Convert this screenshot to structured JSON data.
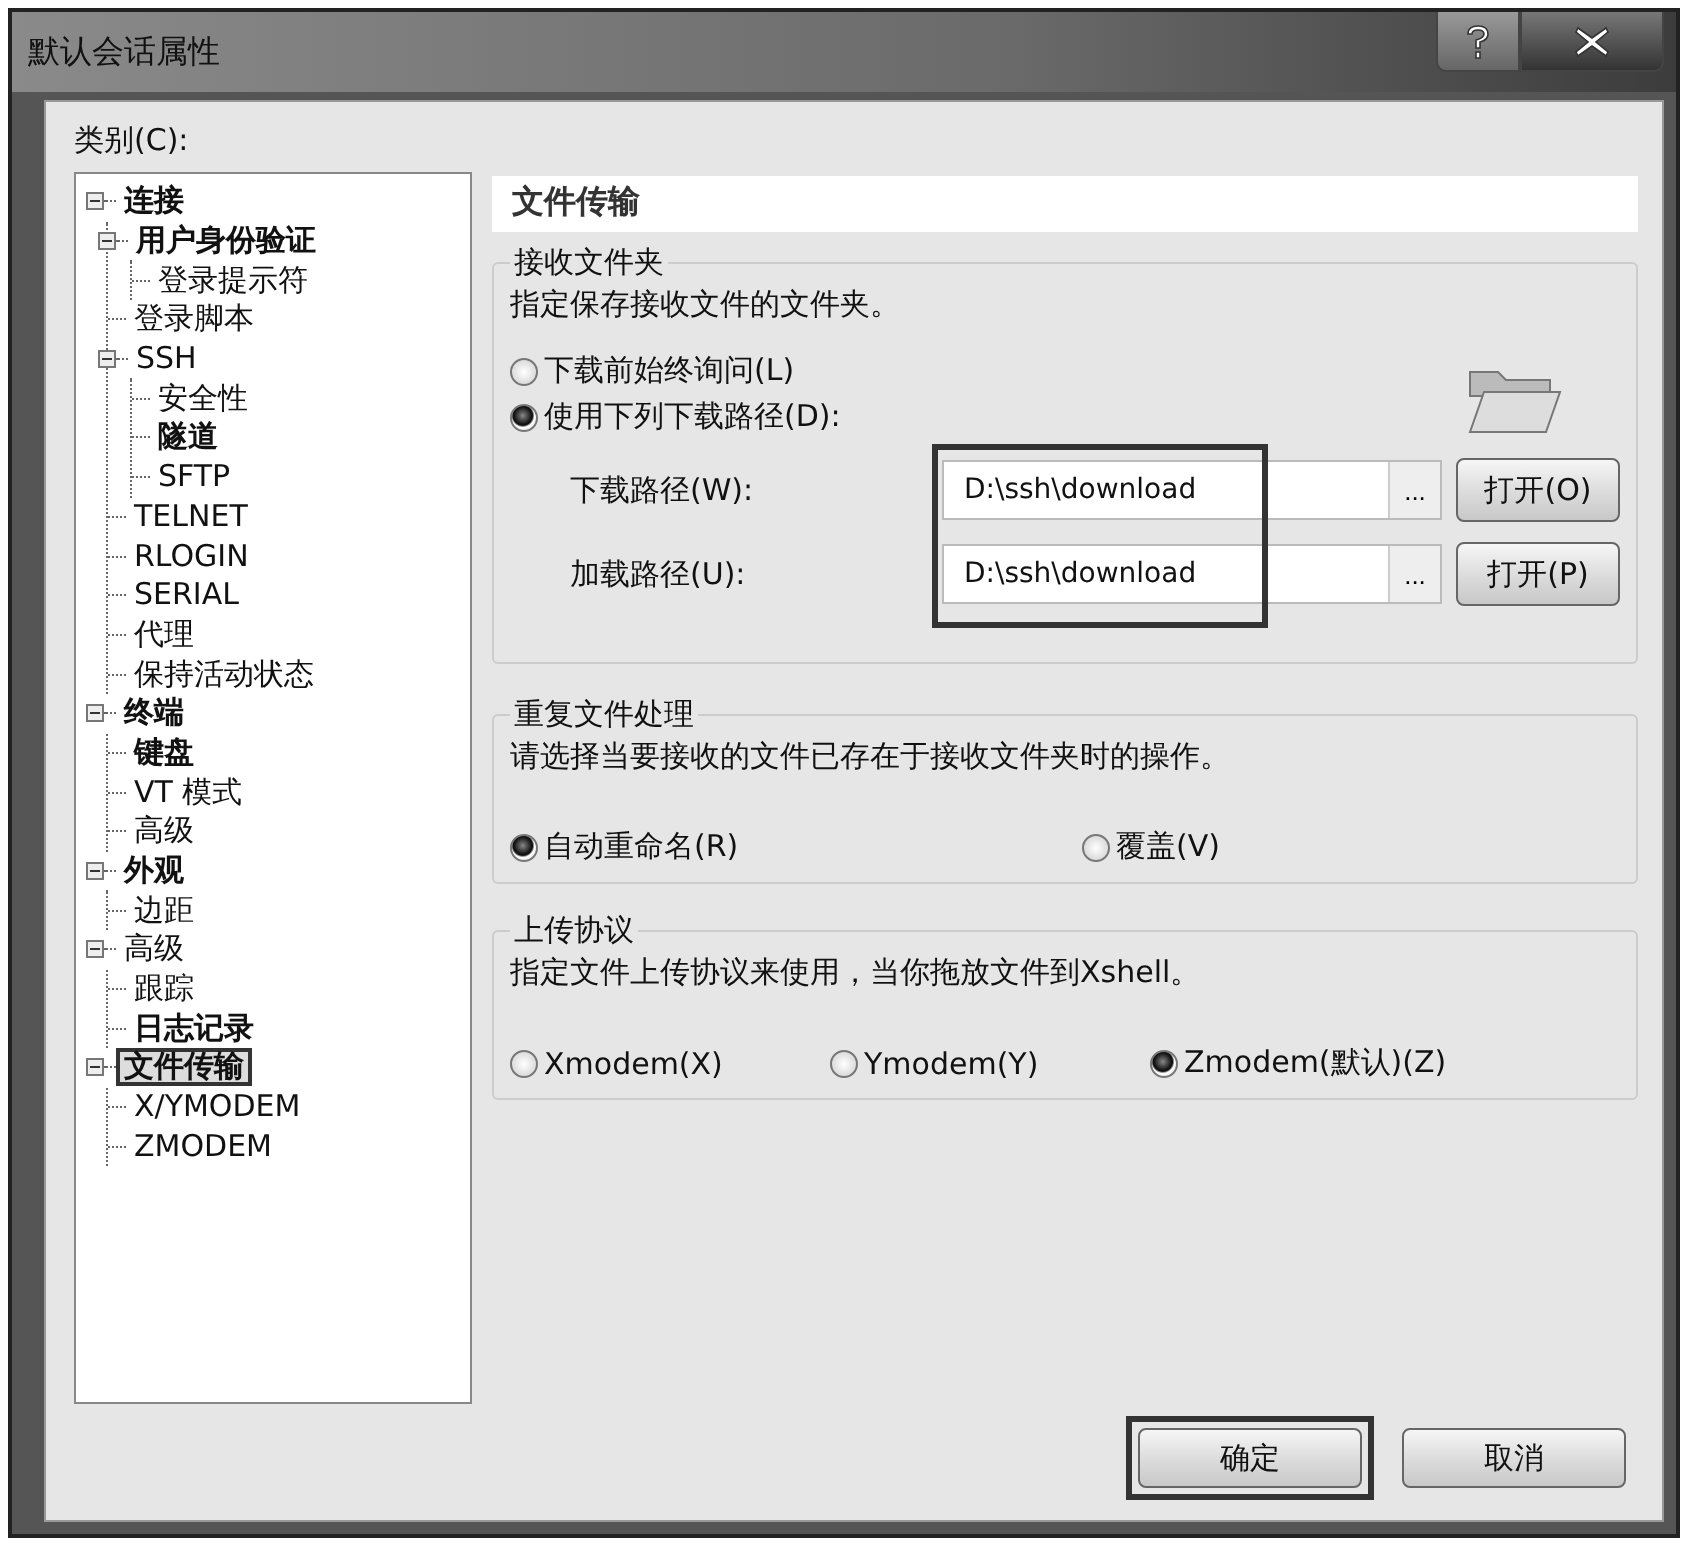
{
  "window": {
    "title": "默认会话属性"
  },
  "category_label": "类别(C):",
  "tree": [
    {
      "label": "连接",
      "bold": true,
      "expanded": true,
      "selected": false,
      "children": [
        {
          "label": "用户身份验证",
          "bold": true,
          "expanded": true,
          "selected": false,
          "children": [
            {
              "label": "登录提示符",
              "bold": false,
              "selected": false
            }
          ]
        },
        {
          "label": "登录脚本",
          "bold": false,
          "selected": false
        },
        {
          "label": "SSH",
          "bold": false,
          "expanded": true,
          "selected": false,
          "children": [
            {
              "label": "安全性",
              "bold": false,
              "selected": false
            },
            {
              "label": "隧道",
              "bold": true,
              "selected": false
            },
            {
              "label": "SFTP",
              "bold": false,
              "selected": false
            }
          ]
        },
        {
          "label": "TELNET",
          "bold": false,
          "selected": false
        },
        {
          "label": "RLOGIN",
          "bold": false,
          "selected": false
        },
        {
          "label": "SERIAL",
          "bold": false,
          "selected": false
        },
        {
          "label": "代理",
          "bold": false,
          "selected": false
        },
        {
          "label": "保持活动状态",
          "bold": false,
          "selected": false
        }
      ]
    },
    {
      "label": "终端",
      "bold": true,
      "expanded": true,
      "selected": false,
      "children": [
        {
          "label": "键盘",
          "bold": true,
          "selected": false
        },
        {
          "label": "VT 模式",
          "bold": false,
          "selected": false
        },
        {
          "label": "高级",
          "bold": false,
          "selected": false
        }
      ]
    },
    {
      "label": "外观",
      "bold": true,
      "expanded": true,
      "selected": false,
      "children": [
        {
          "label": "边距",
          "bold": false,
          "selected": false
        }
      ]
    },
    {
      "label": "高级",
      "bold": false,
      "expanded": true,
      "selected": false,
      "children": [
        {
          "label": "跟踪",
          "bold": false,
          "selected": false
        },
        {
          "label": "日志记录",
          "bold": true,
          "selected": false
        }
      ]
    },
    {
      "label": "文件传输",
      "bold": true,
      "expanded": true,
      "selected": true,
      "children": [
        {
          "label": "X/YMODEM",
          "bold": false,
          "selected": false
        },
        {
          "label": "ZMODEM",
          "bold": false,
          "selected": false
        }
      ]
    }
  ],
  "panel_title": "文件传输",
  "receive_folder": {
    "title": "接收文件夹",
    "description": "指定保存接收文件的文件夹。",
    "options": [
      {
        "label": "下载前始终询问(L)",
        "selected": false
      },
      {
        "label": "使用下列下载路径(D):",
        "selected": true
      }
    ],
    "highlighted": true,
    "paths": [
      {
        "label": "下载路径(W):",
        "value": "D:\\ssh\\download",
        "browse": "...",
        "open": "打开(O)"
      },
      {
        "label": "加载路径(U):",
        "value": "D:\\ssh\\download",
        "browse": "...",
        "open": "打开(P)"
      }
    ]
  },
  "duplicate": {
    "title": "重复文件处理",
    "description": "请选择当要接收的文件已存在于接收文件夹时的操作。",
    "options": [
      {
        "label": "自动重命名(R)",
        "selected": true
      },
      {
        "label": "覆盖(V)",
        "selected": false
      }
    ]
  },
  "upload": {
    "title": "上传协议",
    "description": "指定文件上传协议来使用，当你拖放文件到Xshell。",
    "options": [
      {
        "label": "Xmodem(X)",
        "selected": false
      },
      {
        "label": "Ymodem(Y)",
        "selected": false
      },
      {
        "label": "Zmodem(默认)(Z)",
        "selected": true
      }
    ]
  },
  "buttons": [
    {
      "label": "确定",
      "highlighted": true
    },
    {
      "label": "取消",
      "highlighted": false
    }
  ]
}
